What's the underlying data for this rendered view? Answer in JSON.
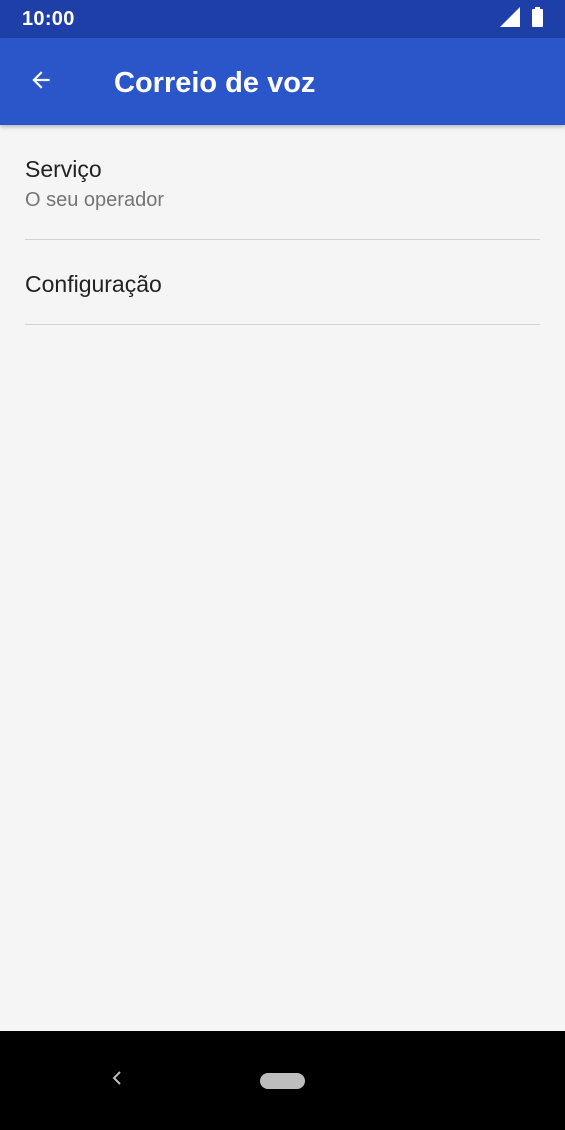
{
  "status_bar": {
    "time": "10:00",
    "icons": [
      "signal-icon",
      "battery-icon"
    ]
  },
  "app_bar": {
    "title": "Correio de voz",
    "back_icon": "arrow-back-icon"
  },
  "preferences": [
    {
      "title": "Serviço",
      "summary": "O seu operador"
    },
    {
      "title": "Configuração"
    }
  ],
  "nav_bar": {
    "back_icon": "chevron-left-icon",
    "home_icon": "home-pill-icon"
  },
  "colors": {
    "status_bar": "#1f3fa8",
    "app_bar": "#2b56c9",
    "background": "#f5f5f5",
    "nav_bar": "#000000"
  }
}
